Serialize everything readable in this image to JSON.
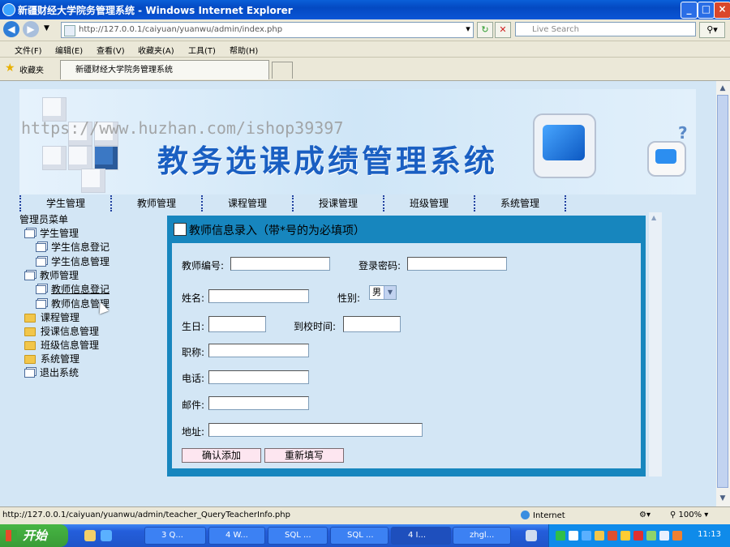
{
  "window": {
    "title": "新疆财经大学院务管理系统 - Windows Internet Explorer"
  },
  "browser": {
    "address": "http://127.0.0.1/caiyuan/yuanwu/admin/index.php",
    "search_placeholder": "Live Search",
    "menu": [
      "文件(F)",
      "编辑(E)",
      "查看(V)",
      "收藏夹(A)",
      "工具(T)",
      "帮助(H)"
    ],
    "favorites_label": "收藏夹",
    "tab_title": "新疆财经大学院务管理系统",
    "status_url": "http://127.0.0.1/caiyuan/yuanwu/admin/teacher_QueryTeacherInfo.php",
    "status_zone": "Internet",
    "zoom": "100%"
  },
  "banner": {
    "watermark": "https://www.huzhan.com/ishop39397",
    "title": "教务选课成绩管理系统"
  },
  "topnav": [
    "学生管理",
    "教师管理",
    "课程管理",
    "授课管理",
    "班级管理",
    "系统管理"
  ],
  "sidebar": {
    "header": "管理员菜单",
    "items": [
      {
        "label": "学生管理",
        "icon": "window-icon",
        "level": 0
      },
      {
        "label": "学生信息登记",
        "icon": "window-icon",
        "level": 1
      },
      {
        "label": "学生信息管理",
        "icon": "window-icon",
        "level": 1
      },
      {
        "label": "教师管理",
        "icon": "window-icon",
        "level": 0
      },
      {
        "label": "教师信息登记",
        "icon": "window-icon",
        "level": 1
      },
      {
        "label": "教师信息管理",
        "icon": "window-icon",
        "level": 1
      },
      {
        "label": "课程管理",
        "icon": "folder-icon",
        "level": 0
      },
      {
        "label": "授课信息管理",
        "icon": "folder-icon",
        "level": 0
      },
      {
        "label": "班级信息管理",
        "icon": "folder-icon",
        "level": 0
      },
      {
        "label": "系统管理",
        "icon": "folder-icon",
        "level": 0
      },
      {
        "label": "退出系统",
        "icon": "window-icon",
        "level": 0
      }
    ]
  },
  "form": {
    "header": "教师信息录入（带*号的为必填项）",
    "labels": {
      "teacher_no": "教师编号:",
      "password": "登录密码:",
      "name": "姓名:",
      "gender": "性别:",
      "birthday": "生日:",
      "arrival": "到校时间:",
      "title": "职称:",
      "phone": "电话:",
      "email": "邮件:",
      "address": "地址:"
    },
    "gender_value": "男",
    "submit_label": "确认添加",
    "reset_label": "重新填写"
  },
  "taskbar": {
    "start_label": "开始",
    "buttons": [
      "3 Q...",
      "4 W...",
      "SQL ...",
      "SQL ...",
      "4 I...",
      "zhgl..."
    ],
    "clock": "11:13"
  }
}
